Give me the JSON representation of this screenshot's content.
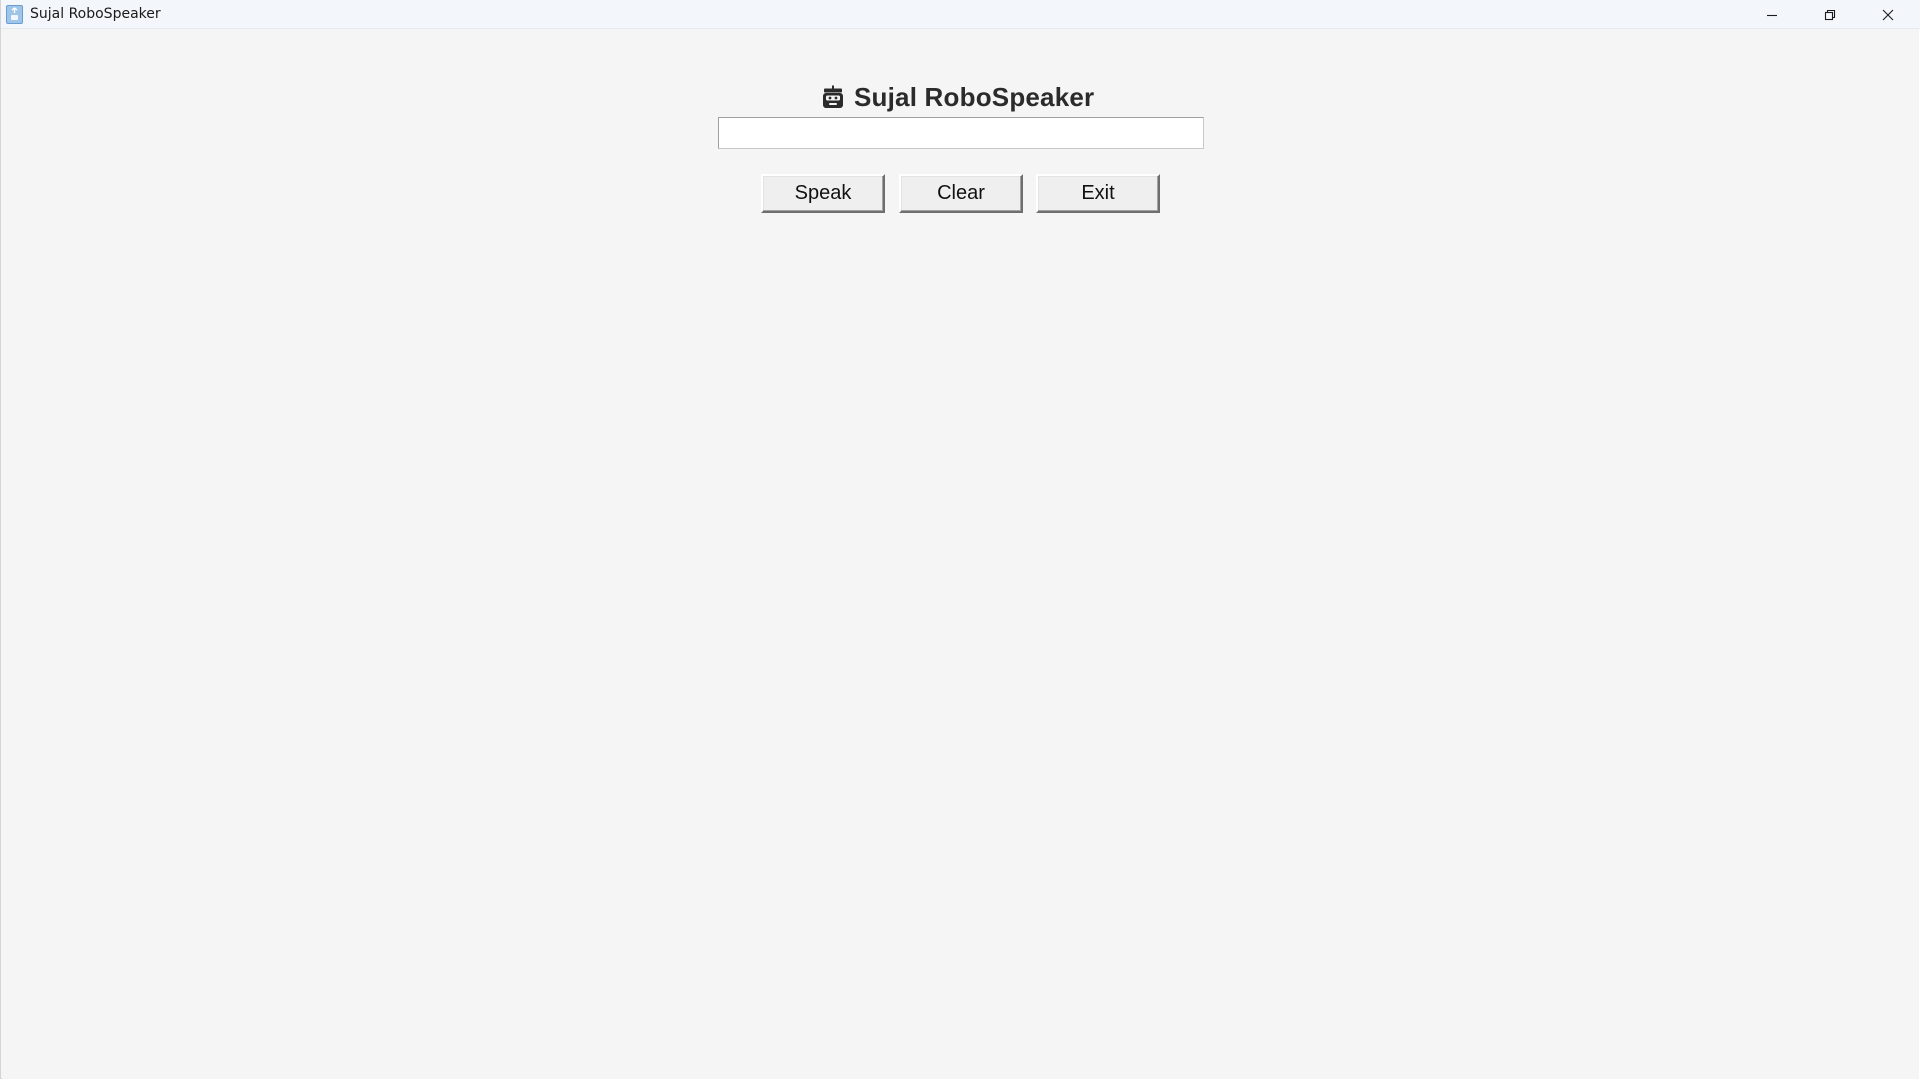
{
  "window": {
    "title": "Sujal RoboSpeaker",
    "controls": {
      "minimize_icon": "minimize-icon",
      "maximize_icon": "restore-icon",
      "close_icon": "close-icon"
    }
  },
  "main": {
    "heading_icon": "robot-icon",
    "heading": "Sujal RoboSpeaker",
    "text_input": {
      "value": "",
      "placeholder": ""
    },
    "buttons": {
      "speak_label": "Speak",
      "clear_label": "Clear",
      "exit_label": "Exit"
    }
  },
  "colors": {
    "background": "#f5f5f5",
    "titlebar": "#f3f6fb",
    "heading_text": "#2b2b2b",
    "button_face": "#efefef"
  }
}
